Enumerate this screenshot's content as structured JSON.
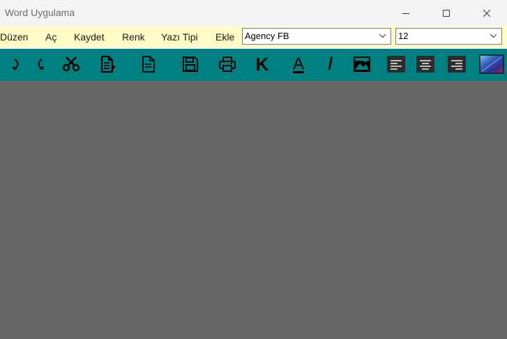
{
  "window": {
    "title": "Word Uygulama",
    "controls": [
      "minimize-icon",
      "maximize-icon",
      "close-icon"
    ]
  },
  "menu": {
    "items": [
      {
        "label": "Düzen"
      },
      {
        "label": "Aç"
      },
      {
        "label": "Kaydet"
      },
      {
        "label": "Renk"
      },
      {
        "label": "Yazı Tipi"
      },
      {
        "label": "Ekle"
      }
    ],
    "font_combo": {
      "value": "Agency FB"
    },
    "size_combo": {
      "value": "12"
    }
  },
  "toolbar": {
    "background": "#008080",
    "icons": [
      "undo-icon",
      "redo-icon",
      "scissors-icon",
      "paste-icon",
      "new-document-icon",
      "save-icon",
      "print-icon",
      "bold-icon",
      "font-color-icon",
      "italic-icon",
      "insert-image-icon",
      "align-left-icon",
      "align-center-icon",
      "align-right-icon",
      "color-palette-icon"
    ],
    "bold_glyph": "K",
    "font_color_glyph": "A",
    "italic_glyph": "/"
  },
  "colors": {
    "menubar": "#fffcc6",
    "document": "#676767",
    "titlebar": "#f3f3f3"
  }
}
